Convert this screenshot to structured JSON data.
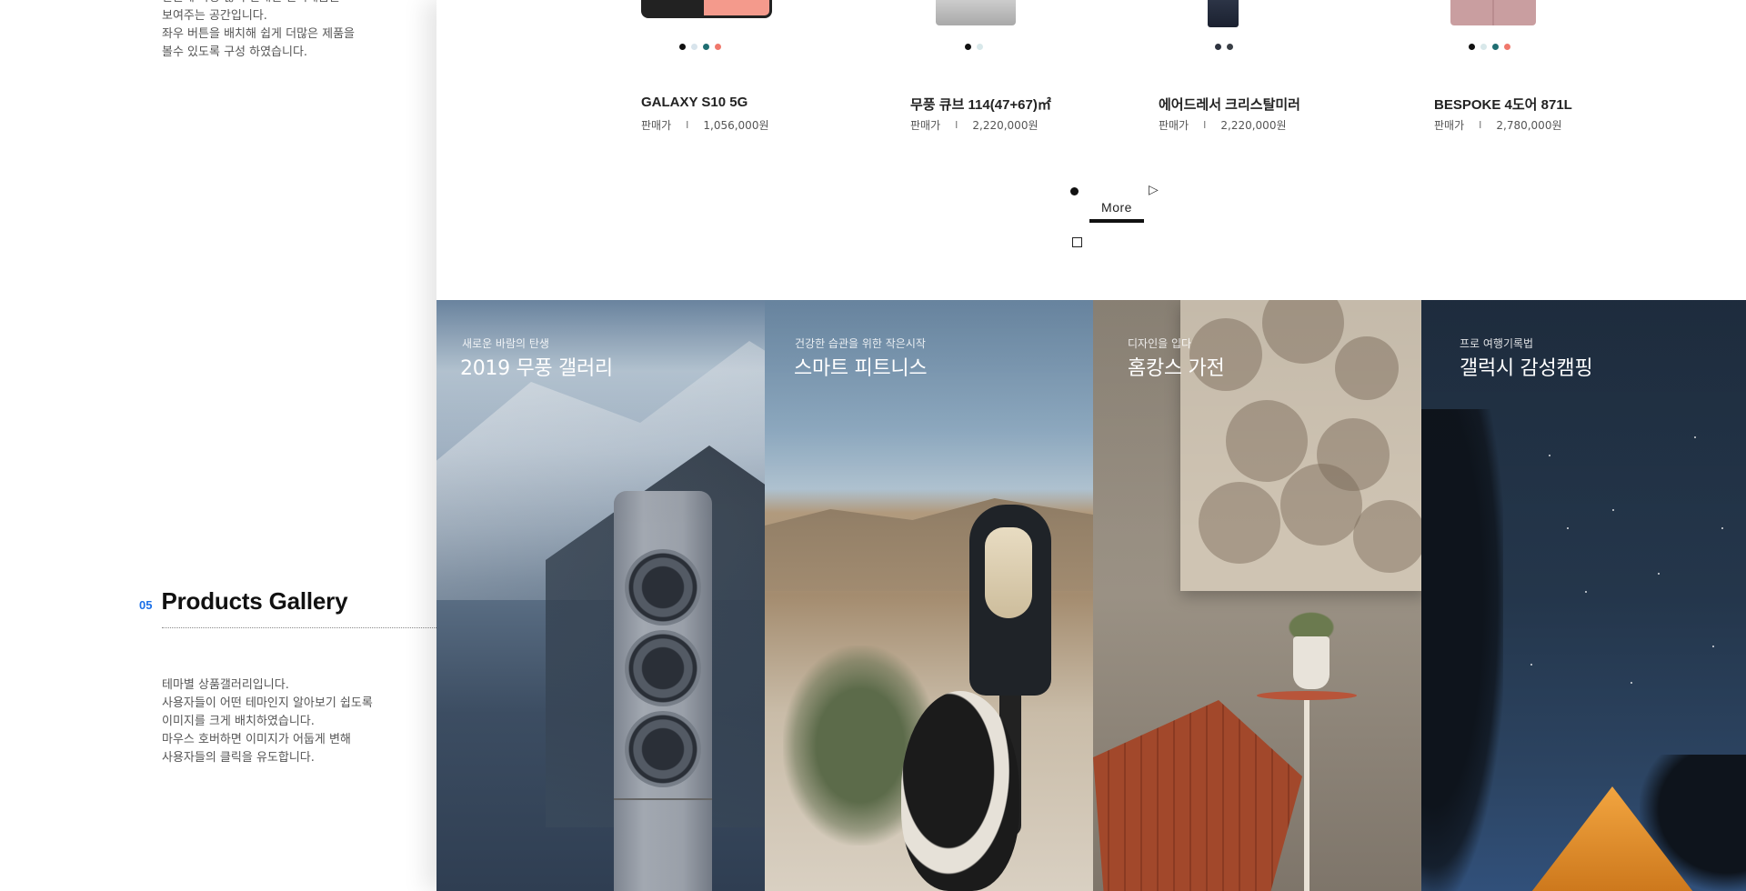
{
  "intro_description": [
    "한눈에 가장 많이 판매된 인기제품을",
    "보여주는 공간입니다.",
    "좌우 버튼을 배치해 쉽게 더많은 제품을",
    "볼수 있도록 구성 하였습니다."
  ],
  "section": {
    "number": "05",
    "title": "Products Gallery",
    "description": [
      "테마별 상품갤러리입니다.",
      "사용자들이 어떤 테마인지 알아보기 쉽도록",
      "이미지를 크게 배치하였습니다.",
      "마우스 호버하면 이미지가 어둡게 변해",
      "사용자들의 클릭을 유도합니다."
    ]
  },
  "products": [
    {
      "name": "GALAXY S10 5G",
      "price_label": "판매가",
      "price": "1,056,000원",
      "colors": [
        "#111111",
        "#d8e4ec",
        "#1f6e72",
        "#f0786c"
      ]
    },
    {
      "name": "무풍 큐브 114(47+67)㎡",
      "price_label": "판매가",
      "price": "2,220,000원",
      "colors": [
        "#111111",
        "#d8e8ea"
      ]
    },
    {
      "name": "에어드레서 크리스탈미러",
      "price_label": "판매가",
      "price": "2,220,000원",
      "colors": [
        "#2e3440",
        "#3a3f46"
      ]
    },
    {
      "name": "BESPOKE 4도어 871L",
      "price_label": "판매가",
      "price": "2,780,000원",
      "colors": [
        "#111111",
        "#d8e8ea",
        "#1f6e72",
        "#f0786c"
      ]
    }
  ],
  "price_separator": "I",
  "controls": {
    "more_label": "More",
    "play_icon": "▷"
  },
  "gallery": [
    {
      "subtitle": "새로운 바람의 탄생",
      "title": "2019 무풍 갤러리"
    },
    {
      "subtitle": "건강한 습관을 위한 작은시작",
      "title": "스마트 피트니스"
    },
    {
      "subtitle": "디자인을 입다",
      "title": "홈캉스 가전"
    },
    {
      "subtitle": "프로 여행기록법",
      "title": "갤럭시 감성캠핑"
    }
  ],
  "colors": {
    "accent": "#1a6fe8"
  }
}
